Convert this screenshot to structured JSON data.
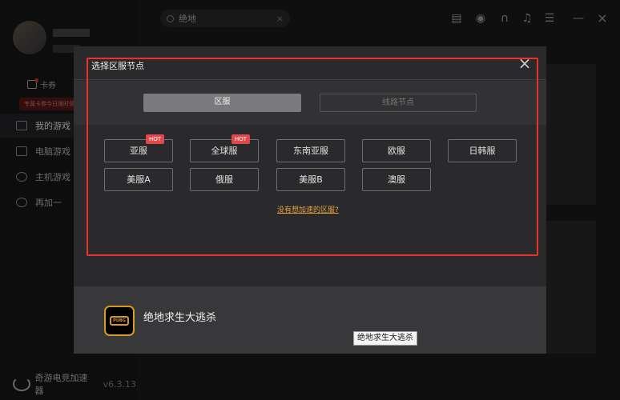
{
  "app": {
    "brand_name": "奇游电竞加速器",
    "version": "v6.3.13",
    "card_ticket": "卡券",
    "promo_text": "专属卡券今日限时领取"
  },
  "sidebar": {
    "items": [
      {
        "label": "我的游戏",
        "icon": "rocket-icon"
      },
      {
        "label": "电脑游戏",
        "icon": "monitor-icon"
      },
      {
        "label": "主机游戏",
        "icon": "gamepad-icon"
      },
      {
        "label": "再加一",
        "icon": "plus-icon"
      }
    ]
  },
  "search": {
    "value": "绝地",
    "clear": "×"
  },
  "topbar": {
    "icons": [
      "list-icon",
      "power-icon",
      "headset-icon",
      "bell-icon",
      "menu-icon",
      "minimize-icon",
      "close-icon"
    ],
    "minimize": "—",
    "close": "×"
  },
  "modal": {
    "title": "选择区服节点",
    "close": "×",
    "tabs": [
      {
        "label": "区服",
        "selected": true
      },
      {
        "label": "线路节点",
        "selected": false
      }
    ],
    "regions": [
      {
        "label": "亚服",
        "badge": "HOT"
      },
      {
        "label": "全球服",
        "badge": "HOT"
      },
      {
        "label": "东南亚服",
        "badge": ""
      },
      {
        "label": "欧服",
        "badge": ""
      },
      {
        "label": "日韩服",
        "badge": ""
      },
      {
        "label": "美服A",
        "badge": ""
      },
      {
        "label": "俄服",
        "badge": ""
      },
      {
        "label": "美服B",
        "badge": ""
      },
      {
        "label": "澳服",
        "badge": ""
      }
    ],
    "help_link": "没有想加速的区服?"
  },
  "game": {
    "name": "绝地求生大逃杀",
    "logo_text": "PUBG",
    "tooltip": "绝地求生大逃杀"
  },
  "colors": {
    "accent": "#e6a23c",
    "hot": "#e0484b",
    "highlight": "#e8322f"
  }
}
